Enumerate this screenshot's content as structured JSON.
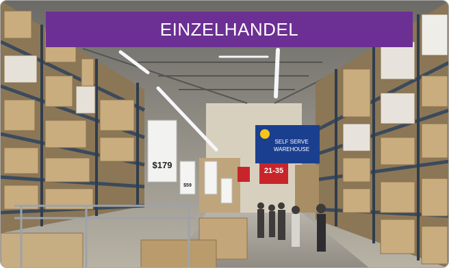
{
  "banner": {
    "title": "EINZELHANDEL",
    "color": "#6c2f93"
  },
  "scene": {
    "subject": "warehouse-store-aisle",
    "price_sign_left": "$179",
    "price_sign_small": "$59",
    "aisle_number": "21-35",
    "self_serve_sign": [
      "SELF SERVE",
      "WAREHOUSE"
    ],
    "sign_color": "#1b3f8f",
    "aisle_sign_color": "#c8252b"
  }
}
